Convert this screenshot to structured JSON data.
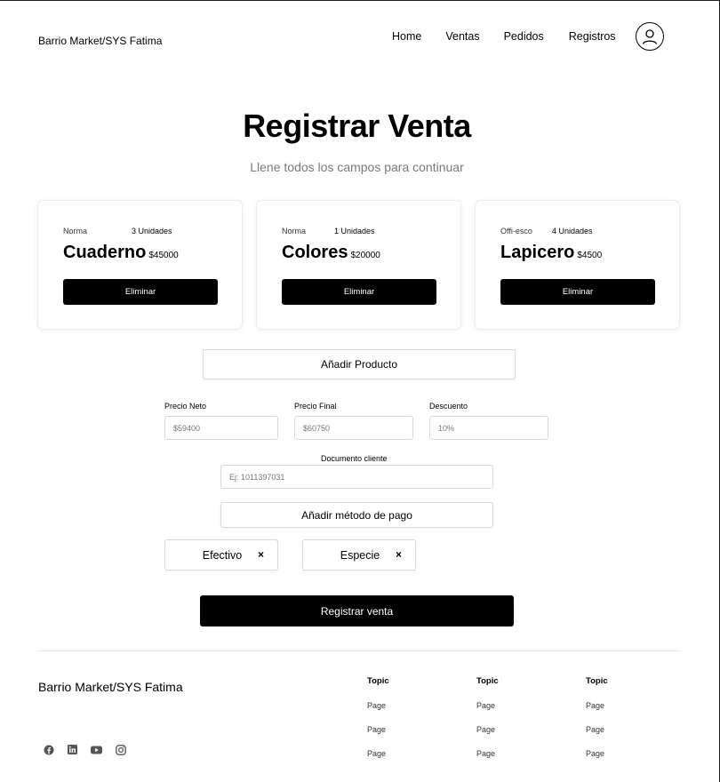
{
  "header": {
    "brand": "Barrio Market/SYS Fatima",
    "nav": [
      "Home",
      "Ventas",
      "Pedidos",
      "Registros"
    ]
  },
  "hero": {
    "title": "Registrar Venta",
    "subtitle": "Llene todos los campos para continuar"
  },
  "products": [
    {
      "category": "Norma",
      "quantity": "3 Unidades",
      "name": "Cuaderno",
      "price": "$45000",
      "button": "Eliminar"
    },
    {
      "category": "Norma",
      "quantity": "1 Unidades",
      "name": "Colores",
      "price": "$20000",
      "button": "Eliminar"
    },
    {
      "category": "Offi-esco",
      "quantity": "4 Unidades",
      "name": "Lapicero",
      "price": "$4500",
      "button": "Eliminar"
    }
  ],
  "form": {
    "add_product": "Añadir Producto",
    "precio_neto_label": "Precio Neto",
    "precio_neto_value": "$59400",
    "precio_final_label": "Precio Final",
    "precio_final_value": "$60750",
    "descuento_label": "Descuento",
    "descuento_value": "10%",
    "documento_label": "Documento cliente",
    "documento_placeholder": "Ej: 1011397031",
    "add_payment": "Añadir método de pago",
    "payment_methods": [
      "Efectivo",
      "Especie"
    ],
    "remove_glyph": "×",
    "submit": "Registrar venta"
  },
  "footer": {
    "brand": "Barrio Market/SYS Fatima",
    "columns": [
      {
        "topic": "Topic",
        "pages": [
          "Page",
          "Page",
          "Page"
        ]
      },
      {
        "topic": "Topic",
        "pages": [
          "Page",
          "Page",
          "Page"
        ]
      },
      {
        "topic": "Topic",
        "pages": [
          "Page",
          "Page",
          "Page"
        ]
      }
    ],
    "social": [
      "facebook-icon",
      "linkedin-icon",
      "youtube-icon",
      "instagram-icon"
    ]
  }
}
